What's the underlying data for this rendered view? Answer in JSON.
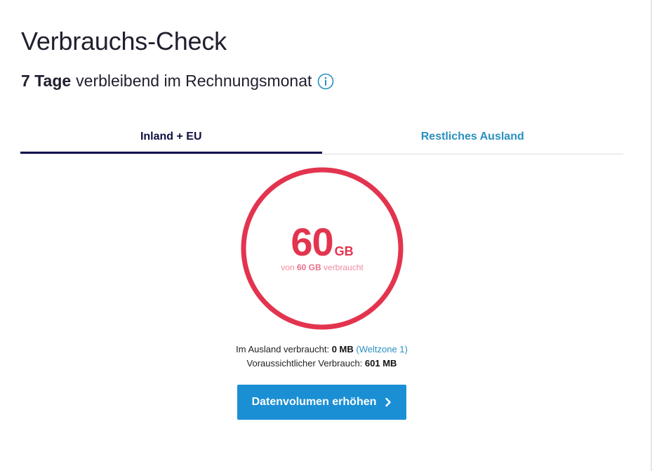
{
  "page": {
    "title": "Verbrauchs-Check"
  },
  "billing": {
    "days_bold": "7 Tage",
    "days_rest": "verbleibend im Rechnungsmonat",
    "info_icon": "info-icon"
  },
  "tabs": [
    {
      "label": "Inland + EU",
      "active": true
    },
    {
      "label": "Restliches Ausland",
      "active": false
    }
  ],
  "usage": {
    "value": "60",
    "unit": "GB",
    "caption_prefix": "von",
    "caption_total": "60 GB",
    "caption_suffix": "verbraucht",
    "used_fraction": 1.0,
    "ring_color": "#e3344f"
  },
  "abroad": {
    "label": "Im Ausland verbraucht:",
    "value": "0 MB",
    "zone": "(Weltzone 1)"
  },
  "forecast": {
    "label": "Voraussichtlicher Verbrauch:",
    "value": "601 MB"
  },
  "cta": {
    "label": "Datenvolumen erhöhen",
    "icon": "chevron-right-icon",
    "color": "#1b8fd4"
  }
}
